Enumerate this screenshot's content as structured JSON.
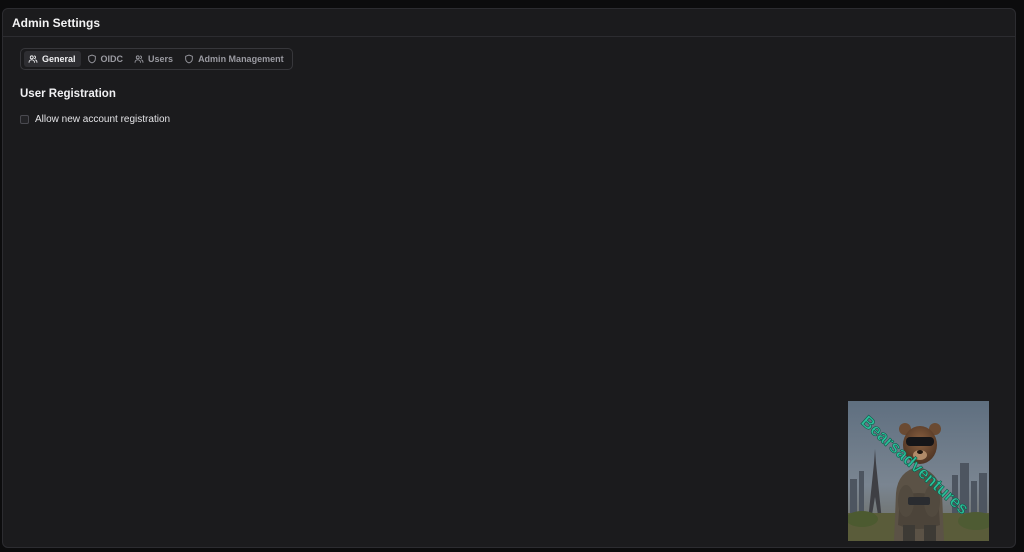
{
  "panel": {
    "title": "Admin Settings"
  },
  "tabs": [
    {
      "label": "General",
      "icon": "users-icon",
      "active": true
    },
    {
      "label": "OIDC",
      "icon": "shield-icon",
      "active": false
    },
    {
      "label": "Users",
      "icon": "users-icon",
      "active": false
    },
    {
      "label": "Admin Management",
      "icon": "shield-icon",
      "active": false
    }
  ],
  "section": {
    "title": "User Registration",
    "checkbox_label": "Allow new account registration",
    "checked": false
  },
  "widget": {
    "watermark": "Bearsadventures",
    "icon": "bear-with-sunglasses-image"
  },
  "colors": {
    "background": "#0c0c0d",
    "panel": "#1b1b1d",
    "border": "#2c2c30",
    "active_tab": "#2e2e32",
    "watermark": "#2bbf9a"
  }
}
